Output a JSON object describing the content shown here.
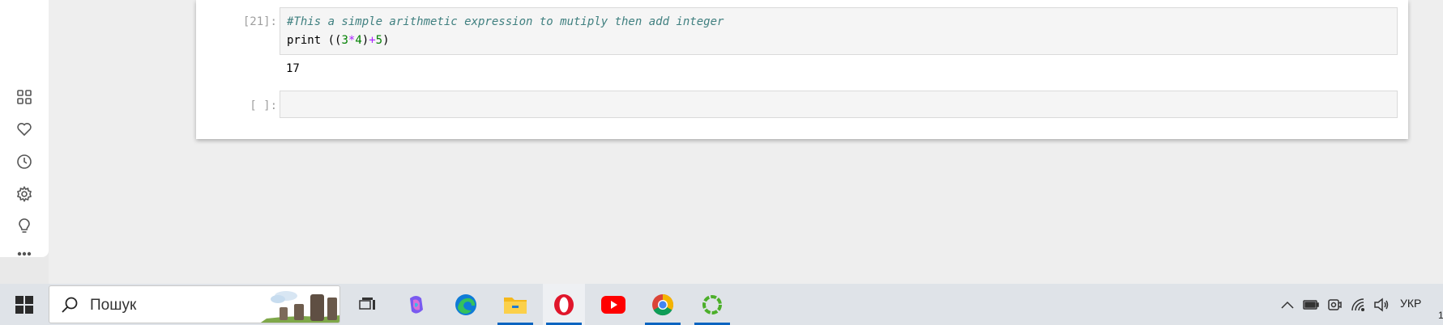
{
  "sidebar": {
    "items": [
      {
        "icon": "apps-grid-icon"
      },
      {
        "icon": "heart-icon"
      },
      {
        "icon": "clock-icon"
      },
      {
        "icon": "gear-icon"
      },
      {
        "icon": "lightbulb-icon"
      },
      {
        "icon": "more-dots-icon"
      }
    ]
  },
  "notebook": {
    "cells": [
      {
        "prompt": "[21]:",
        "code": {
          "comment": "#This a simple arithmetic expression to mutiply then add integer",
          "tokens": [
            "print ((",
            "3",
            "*",
            "4",
            ")",
            "+",
            "5",
            ")"
          ]
        },
        "output": "17"
      },
      {
        "prompt": "[ ]:",
        "code": null,
        "output": null
      }
    ]
  },
  "taskbar": {
    "search_placeholder": "Пошук",
    "apps": [
      {
        "name": "task-view",
        "icon": "task-view-icon"
      },
      {
        "name": "copilot",
        "icon": "copilot-icon"
      },
      {
        "name": "edge",
        "icon": "edge-icon"
      },
      {
        "name": "file-explorer",
        "icon": "folder-icon",
        "running": true
      },
      {
        "name": "opera",
        "icon": "opera-icon",
        "running": true,
        "active": true
      },
      {
        "name": "youtube",
        "icon": "youtube-icon"
      },
      {
        "name": "chrome",
        "icon": "chrome-icon",
        "running": true
      },
      {
        "name": "jupyter-app",
        "icon": "green-ring-icon",
        "running": true
      }
    ],
    "tray": {
      "language": "УКР",
      "clock_fragment": "1"
    }
  },
  "colors": {
    "comment": "#408080",
    "number": "#008000",
    "operator": "#aa22ff",
    "taskbar_bg": "#dfe3e8",
    "running_underline": "#0a64c0"
  }
}
